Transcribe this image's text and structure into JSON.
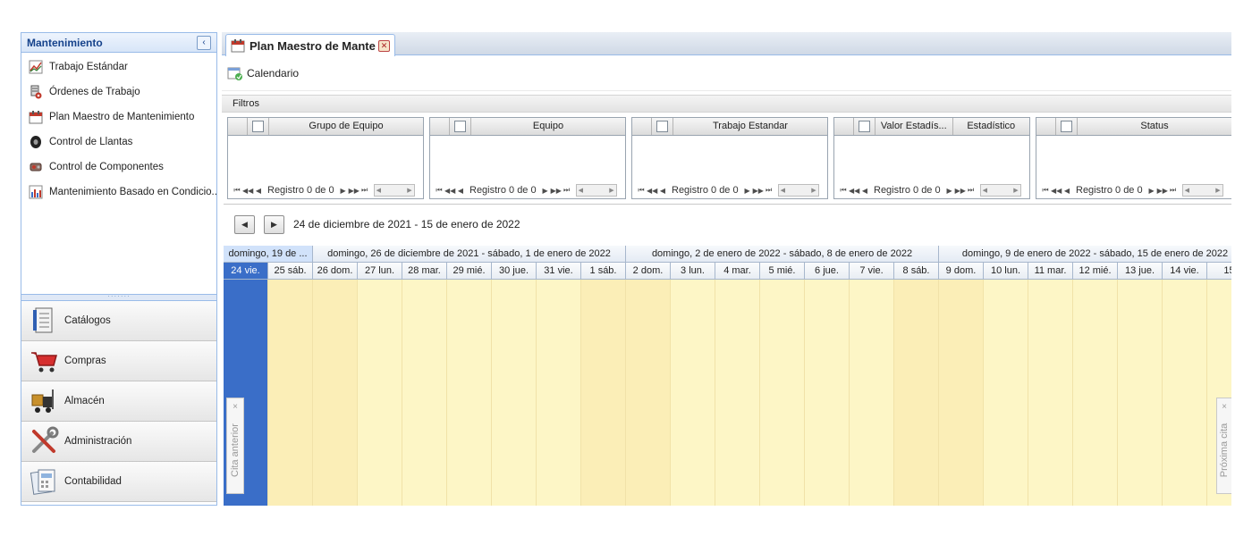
{
  "sidebar": {
    "title": "Mantenimiento",
    "collapse_icon": "‹",
    "items": [
      {
        "label": "Trabajo Estándar",
        "icon": "chart-icon"
      },
      {
        "label": "Órdenes de Trabajo",
        "icon": "work-order-icon"
      },
      {
        "label": "Plan Maestro de Mantenimiento",
        "icon": "calendar-icon"
      },
      {
        "label": "Control de Llantas",
        "icon": "tire-icon"
      },
      {
        "label": "Control de Componentes",
        "icon": "engine-icon"
      },
      {
        "label": "Mantenimiento Basado en Condicio...",
        "icon": "bar-chart-icon"
      }
    ],
    "splitter_grip": "·······",
    "sections": [
      {
        "label": "Catálogos",
        "icon": "catalog-icon"
      },
      {
        "label": "Compras",
        "icon": "shopping-cart-icon"
      },
      {
        "label": "Almacén",
        "icon": "forklift-icon"
      },
      {
        "label": "Administración",
        "icon": "tools-icon"
      },
      {
        "label": "Contabilidad",
        "icon": "accounting-icon"
      }
    ]
  },
  "tab": {
    "label": "Plan Maestro de Mante",
    "close": "✕"
  },
  "toolbar": {
    "calendar_label": "Calendario"
  },
  "filters": {
    "title": "Filtros",
    "grids": [
      {
        "columns": [
          "Grupo de Equipo"
        ],
        "record_text": "Registro 0 de 0"
      },
      {
        "columns": [
          "Equipo"
        ],
        "record_text": "Registro 0 de 0"
      },
      {
        "columns": [
          "Trabajo Estandar"
        ],
        "record_text": "Registro 0 de 0"
      },
      {
        "columns": [
          "Valor Estadís...",
          "Estadístico"
        ],
        "record_text": "Registro 0 de 0"
      },
      {
        "columns": [
          "Status"
        ],
        "record_text": "Registro 0 de 0"
      }
    ],
    "pager_glyphs": {
      "first": "⏮",
      "prev_page": "◀◀",
      "prev": "◀",
      "next": "▶",
      "next_page": "▶▶",
      "last": "⏭"
    }
  },
  "calendar": {
    "prev_label": "◀",
    "next_label": "▶",
    "date_range": "24 de diciembre de 2021 - 15 de enero de 2022",
    "weeks": [
      {
        "label": "domingo, 19 de ...",
        "selected": true
      },
      {
        "label": "domingo, 26 de diciembre de 2021 - sábado, 1 de enero de 2022",
        "selected": false
      },
      {
        "label": "domingo, 2 de enero de 2022 - sábado, 8 de enero de 2022",
        "selected": false
      },
      {
        "label": "domingo, 9 de enero de 2022 - sábado, 15 de enero de 2022",
        "selected": false
      }
    ],
    "days": [
      {
        "label": "24 vie.",
        "selected": true
      },
      {
        "label": "25 sáb.",
        "weekend": true
      },
      {
        "label": "26 dom.",
        "weekend": true
      },
      {
        "label": "27 lun."
      },
      {
        "label": "28 mar."
      },
      {
        "label": "29 mié."
      },
      {
        "label": "30 jue."
      },
      {
        "label": "31 vie."
      },
      {
        "label": "1 sáb.",
        "weekend": true
      },
      {
        "label": "2 dom.",
        "weekend": true
      },
      {
        "label": "3 lun."
      },
      {
        "label": "4 mar."
      },
      {
        "label": "5 mié."
      },
      {
        "label": "6 jue."
      },
      {
        "label": "7 vie."
      },
      {
        "label": "8 sáb.",
        "weekend": true
      },
      {
        "label": "9 dom.",
        "weekend": true
      },
      {
        "label": "10 lun."
      },
      {
        "label": "11 mar."
      },
      {
        "label": "12 mié."
      },
      {
        "label": "13 jue."
      },
      {
        "label": "14 vie."
      },
      {
        "label": "15"
      }
    ],
    "prev_appointment": "Cita anterior",
    "next_appointment": "Próxima cita",
    "close_glyph": "×"
  },
  "colors": {
    "accent": "#15428b",
    "selected_day": "#3a6ec8",
    "workday": "#fdf6c6",
    "weekend": "#fbeeb7"
  }
}
